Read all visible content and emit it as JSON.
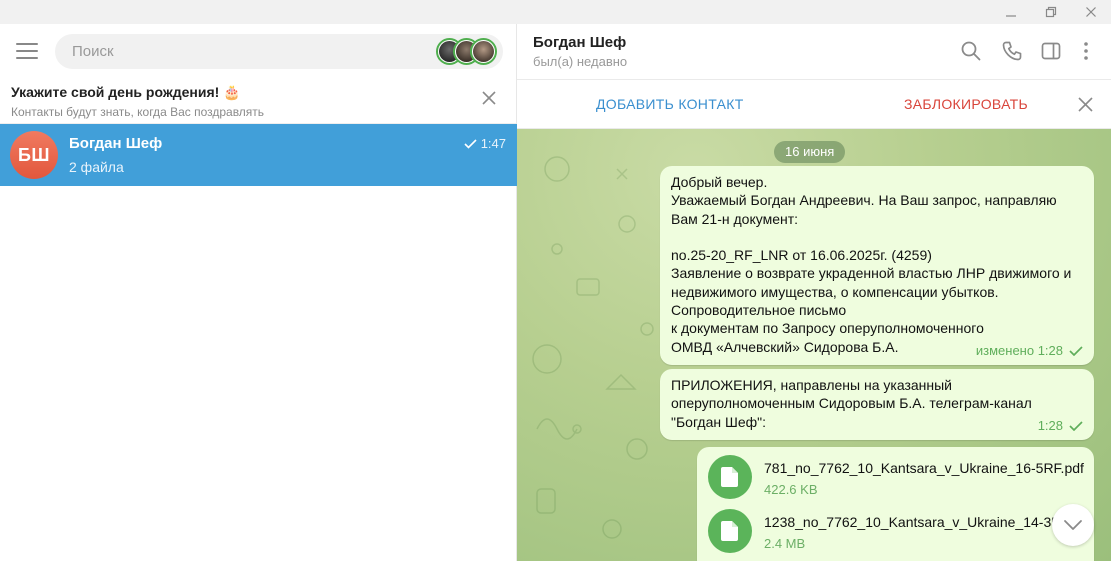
{
  "search": {
    "placeholder": "Поиск"
  },
  "birthday": {
    "title": "Укажите свой день рождения! 🎂",
    "subtitle": "Контакты будут знать, когда Вас поздравлять"
  },
  "chat_list": [
    {
      "initials": "БШ",
      "name": "Богдан Шеф",
      "preview": "2 файла",
      "time": "1:47"
    }
  ],
  "header": {
    "name": "Богдан Шеф",
    "status": "был(а) недавно"
  },
  "actions": {
    "add_contact": "ДОБАВИТЬ КОНТАКТ",
    "block": "ЗАБЛОКИРОВАТЬ"
  },
  "date_chip": "16 июня",
  "messages": [
    {
      "lines": [
        "Добрый вечер.",
        "Уважаемый Богдан Андреевич. На Ваш запрос, направляю",
        "Вам 21-н документ:",
        "",
        "no.25-20_RF_LNR от 16.06.2025г. (4259)",
        "Заявление о возврате украденной властью ЛНР движимого и",
        "недвижимого имущества, о компенсации убытков.",
        "Сопроводительное письмо",
        "к документам по Запросу оперуполномоченного",
        "ОМВД «Алчевский» Сидорова Б.А."
      ],
      "meta": "изменено 1:28"
    },
    {
      "lines": [
        "ПРИЛОЖЕНИЯ, направлены на указанный",
        "оперуполномоченным Сидоровым Б.А. телеграм-канал",
        "\"Богдан Шеф\":"
      ],
      "meta": "1:28"
    }
  ],
  "files": [
    {
      "name": "781_no_7762_10_Kantsara_v_Ukraine_16-5RF.pdf",
      "size": "422.6 KB"
    },
    {
      "name": "1238_no_7762_10_Kantsara_v_Ukraine_14-35.pdf",
      "size": "2.4 MB"
    }
  ],
  "colors": {
    "accent": "#419fd9",
    "bubble": "#effdde",
    "check": "#5fae5b",
    "block": "#d9453b",
    "link": "#3a8fcf"
  },
  "icons": [
    "menu-icon",
    "search-icon",
    "phone-icon",
    "sidebar-toggle-icon",
    "more-icon",
    "close-icon",
    "file-icon",
    "chevron-down-icon",
    "check-icon",
    "minimize-icon",
    "restore-icon"
  ]
}
